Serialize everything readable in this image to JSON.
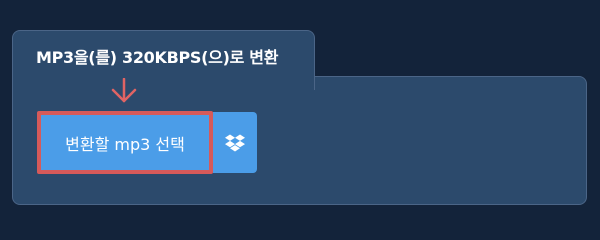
{
  "converter": {
    "title": "MP3을(를) 320KBPS(으)로 변환",
    "select_button_label": "변환할 mp3 선택",
    "dropbox_icon": "dropbox-icon",
    "arrow_icon": "arrow-down-icon"
  },
  "colors": {
    "page_background": "#13233a",
    "panel_background": "#2c4a6c",
    "panel_border": "#4b6587",
    "button_background": "#4b9de8",
    "highlight_border": "#d65a5a",
    "text": "#ffffff"
  }
}
